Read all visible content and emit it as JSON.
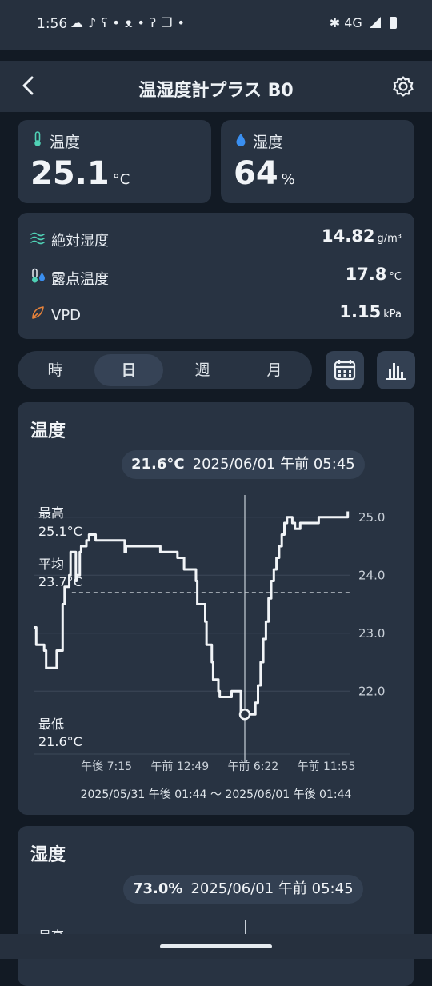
{
  "status": {
    "time": "1:56",
    "network": "4G",
    "dot": "•"
  },
  "header": {
    "title": "温湿度計プラス B0"
  },
  "temp_card": {
    "label": "温度",
    "value": "25.1",
    "unit": "°C"
  },
  "humid_card": {
    "label": "湿度",
    "value": "64",
    "unit": "%"
  },
  "metrics": [
    {
      "label": "絶対湿度",
      "value": "14.82",
      "unit": "g/m³",
      "icon": "wind-icon"
    },
    {
      "label": "露点温度",
      "value": "17.8",
      "unit": "°C",
      "icon": "dew-point-icon"
    },
    {
      "label": "VPD",
      "value": "1.15",
      "unit": "kPa",
      "icon": "leaf-icon"
    }
  ],
  "range_tabs": {
    "items": [
      "時",
      "日",
      "週",
      "月"
    ],
    "selected": "日"
  },
  "chart1": {
    "title": "温度",
    "tooltip_value": "21.6°C",
    "tooltip_time": "2025/06/01 午前 05:45",
    "max_label": "最高",
    "max_value": "25.1°C",
    "avg_label": "平均",
    "avg_value": "23.7°C",
    "min_label": "最低",
    "min_value": "21.6°C",
    "range_label": "2025/05/31 午後 01:44 〜 2025/06/01 午後 01:44"
  },
  "chart2": {
    "title": "湿度",
    "tooltip_value": "73.0%",
    "tooltip_time": "2025/06/01 午前 05:45",
    "max_label": "最高"
  },
  "chart_data": {
    "type": "line",
    "ylim": [
      21.3,
      25.3
    ],
    "yticks": [
      "25.0",
      "24.0",
      "23.0",
      "22.0"
    ],
    "yticks_values": [
      25.0,
      24.0,
      23.0,
      22.0
    ],
    "xticks": [
      "午後 7:15",
      "午前 12:49",
      "午前 6:22",
      "午前 11:55"
    ],
    "xticks_values": [
      5.52,
      11.08,
      16.63,
      22.18
    ],
    "x_unit_range": [
      0,
      24
    ],
    "average": 23.7,
    "cursor_x": 16.0,
    "series": [
      {
        "x": [
          0,
          0.2,
          0.35,
          0.8,
          0.95,
          1.6,
          1.75,
          2.2,
          2.35,
          2.7,
          2.8,
          3.0,
          3.2,
          3.25,
          3.5,
          3.6,
          3.8,
          4.0,
          4.2,
          4.3,
          4.6,
          4.7,
          4.9,
          5.0,
          6.0,
          6.2,
          6.9,
          7.0,
          9.5,
          9.6,
          10.8,
          10.9,
          11.3,
          11.4,
          12.3,
          12.4,
          13.0,
          13.1,
          13.5,
          13.6,
          14.0,
          14.1,
          14.8,
          15.0,
          15.7,
          15.8,
          16.0,
          16.2,
          16.5,
          16.8,
          17.0,
          17.2,
          17.4,
          17.6,
          17.8,
          18.0,
          18.2,
          18.4,
          18.6,
          18.8,
          19.0,
          19.2,
          19.4,
          19.6,
          19.8,
          20.0,
          20.2,
          20.5,
          20.7,
          21.5,
          21.6,
          23.4,
          23.5,
          23.7,
          23.8
        ],
        "y": [
          23.1,
          22.8,
          22.8,
          22.7,
          22.4,
          22.4,
          22.7,
          23.5,
          23.8,
          24.0,
          24.4,
          24.4,
          23.9,
          24.0,
          24.4,
          24.5,
          24.5,
          24.6,
          24.7,
          24.7,
          24.7,
          24.6,
          24.6,
          24.6,
          24.6,
          24.6,
          24.4,
          24.5,
          24.5,
          24.4,
          24.4,
          24.3,
          24.3,
          24.1,
          23.9,
          23.5,
          23.2,
          22.8,
          22.5,
          22.2,
          22.0,
          21.9,
          21.9,
          22.0,
          21.6,
          21.6,
          21.6,
          21.6,
          21.6,
          21.8,
          22.1,
          22.5,
          22.9,
          23.2,
          23.6,
          23.9,
          24.1,
          24.3,
          24.5,
          24.7,
          24.9,
          25.0,
          25.0,
          24.9,
          24.8,
          24.8,
          24.9,
          24.9,
          24.9,
          24.9,
          25.0,
          25.0,
          25.0,
          25.0,
          25.1
        ]
      }
    ]
  }
}
